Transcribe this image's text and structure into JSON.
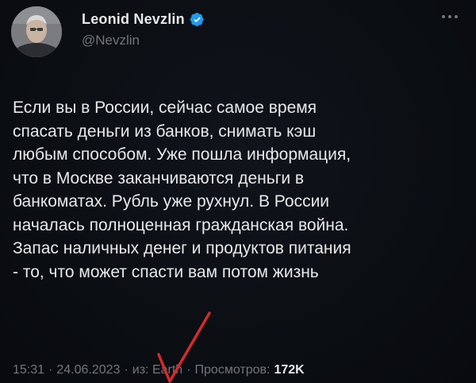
{
  "author": {
    "display_name": "Leonid Nevzlin",
    "handle": "@Nevzlin",
    "verified": true
  },
  "more_icon": "more-horizontal-icon",
  "tweet": {
    "text": "Если вы в России, сейчас самое время\nспасать деньги из банков, снимать кэш\nлюбым способом. Уже пошла информация,\nчто в Москве заканчиваются деньги в\nбанкоматах. Рубль уже рухнул. В России\nначалась полноценная гражданская война.\nЗапас наличных денег и продуктов питания\n- то, что может спасти вам потом жизнь"
  },
  "meta": {
    "time": "15:31",
    "date": "24.06.2023",
    "separator": "·",
    "source": "из: Earth",
    "views_label": "Просмотров:",
    "views_count": "172K"
  },
  "colors": {
    "background": "#0b0e13",
    "text_primary": "#e7e9ea",
    "text_secondary": "#71767b",
    "verified_badge": "#1d9bf0",
    "annotation_mark": "#d62a2a"
  },
  "annotation": {
    "icon": "red-checkmark-icon"
  }
}
